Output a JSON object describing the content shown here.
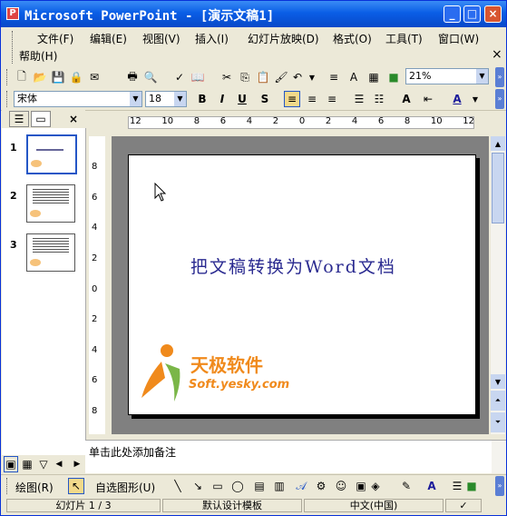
{
  "window": {
    "title": "Microsoft PowerPoint - [演示文稿1]",
    "app_icon_letter": "P"
  },
  "title_buttons": {
    "minimize": "_",
    "maximize": "□",
    "close": "×"
  },
  "menubar": {
    "items": [
      "文件(F)",
      "编辑(E)",
      "视图(V)",
      "插入(I)",
      "幻灯片放映(D)",
      "格式(O)",
      "工具(T)",
      "窗口(W)",
      "帮助(H)"
    ],
    "close_glyph": "×"
  },
  "standard_toolbar": {
    "zoom": "21%"
  },
  "formatting_toolbar": {
    "font": "宋体",
    "size": "18",
    "bold": "B",
    "italic": "I",
    "underline": "U",
    "shadow": "S",
    "grow_font": "A",
    "font_color": "A"
  },
  "outline_pane": {
    "tab_outline_icon": "outline-icon",
    "tab_slides_icon": "slides-icon",
    "close_glyph": "×",
    "slides": [
      {
        "number": "1"
      },
      {
        "number": "2"
      },
      {
        "number": "3"
      }
    ]
  },
  "slide": {
    "title": "把文稿转换为Word文档",
    "logo_text": "天极软件",
    "logo_subtext": "Soft.yesky.com"
  },
  "rulers": {
    "h_labels": [
      "12",
      "10",
      "8",
      "6",
      "4",
      "2",
      "0",
      "2",
      "4",
      "6",
      "8",
      "10",
      "12"
    ],
    "v_labels": [
      "8",
      "6",
      "4",
      "2",
      "0",
      "2",
      "4",
      "6",
      "8"
    ]
  },
  "notes": {
    "placeholder": "单击此处添加备注"
  },
  "drawing_toolbar": {
    "draw_menu": "绘图(R)",
    "autoshapes_menu": "自选图形(U)"
  },
  "statusbar": {
    "slide_info": "幻灯片 1 / 3",
    "design": "默认设计模板",
    "language": "中文(中国)"
  },
  "colors": {
    "titlebar": "#0a5ee6",
    "slide_title": "#2a2a90",
    "logo_orange": "#f08a1c",
    "logo_green": "#7ab648"
  }
}
